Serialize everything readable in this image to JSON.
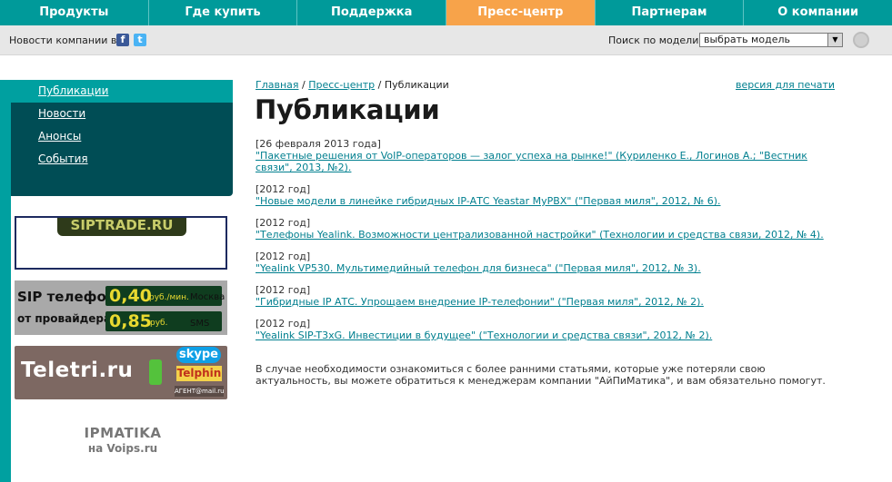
{
  "nav": {
    "tabs": [
      {
        "label": "Продукты"
      },
      {
        "label": "Где купить"
      },
      {
        "label": "Поддержка"
      },
      {
        "label": "Пресс-центр",
        "active": true
      },
      {
        "label": "Партнерам"
      },
      {
        "label": "О компании"
      }
    ]
  },
  "subbar": {
    "news_label": "Новости компании в:",
    "facebook_icon": "facebook-icon",
    "twitter_icon": "twitter-icon",
    "search_label": "Поиск по модели:",
    "model_select_value": "выбрать модель"
  },
  "sidebar": {
    "items": [
      {
        "label": "Публикации",
        "active": true
      },
      {
        "label": "Новости"
      },
      {
        "label": "Анонсы"
      },
      {
        "label": "События"
      }
    ]
  },
  "banners": {
    "siptrade": {
      "text": "SIPTRADE.RU"
    },
    "sip": {
      "line1": "SIP телефония",
      "line2": "от провайдера",
      "price1": "0,40",
      "unit1": "руб./мин.",
      "label1": "Москва",
      "price2": "0,85",
      "unit2": "руб.",
      "label2": "SMS"
    },
    "teletri": {
      "brand": "Teletri.ru",
      "skype": "skype",
      "telphin": "Telphin",
      "agent": "АГЕНТ@mail.ru"
    }
  },
  "ipmatika": {
    "line1": "IPMATIKA",
    "line2": "на Voips.ru"
  },
  "breadcrumb": {
    "home": "Главная",
    "sep1": " / ",
    "press": "Пресс-центр",
    "sep2": " / ",
    "current": "Публикации"
  },
  "print_link": "версия для печати",
  "page_title": "Публикации",
  "publications": [
    {
      "date": "[26 февраля 2013 года]",
      "title": "\"Пакетные решения от VoIP-операторов — залог успеха на рынке!\" (Куриленко Е., Логинов А.; \"Вестник связи\", 2013, №2)."
    },
    {
      "date": "[2012 год]",
      "title": "\"Новые модели в линейке гибридных IP-АТС Yeastar MyPBX\" (\"Первая миля\", 2012, № 6)."
    },
    {
      "date": "[2012 год]",
      "title": "\"Телефоны Yealink. Возможности централизованной настройки\" (Технологии и средства связи, 2012, № 4)."
    },
    {
      "date": "[2012 год]",
      "title": "\"Yealink VP530. Мультимедийный телефон для бизнеса\" (\"Первая миля\", 2012, № 3)."
    },
    {
      "date": "[2012 год]",
      "title": "\"Гибридные IP АТС. Упрощаем внедрение IP-телефонии\" (\"Первая миля\", 2012, № 2)."
    },
    {
      "date": "[2012 год]",
      "title": "\"Yealink SIP-T3xG. Инвестиции в будущее\" (\"Технологии и средства связи\", 2012, № 2)."
    }
  ],
  "note": "В случае необходимости ознакомиться с более ранними статьями, которые уже потеряли свою актуальность, вы можете обратиться к менеджерам компании \"АйПиМатика\", и вам обязательно помогут."
}
